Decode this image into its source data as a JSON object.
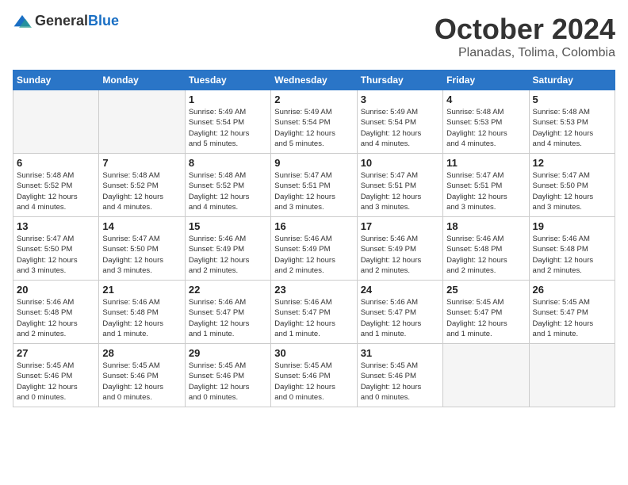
{
  "logo": {
    "general": "General",
    "blue": "Blue"
  },
  "header": {
    "month": "October 2024",
    "location": "Planadas, Tolima, Colombia"
  },
  "weekdays": [
    "Sunday",
    "Monday",
    "Tuesday",
    "Wednesday",
    "Thursday",
    "Friday",
    "Saturday"
  ],
  "weeks": [
    [
      {
        "day": "",
        "info": ""
      },
      {
        "day": "",
        "info": ""
      },
      {
        "day": "1",
        "info": "Sunrise: 5:49 AM\nSunset: 5:54 PM\nDaylight: 12 hours\nand 5 minutes."
      },
      {
        "day": "2",
        "info": "Sunrise: 5:49 AM\nSunset: 5:54 PM\nDaylight: 12 hours\nand 5 minutes."
      },
      {
        "day": "3",
        "info": "Sunrise: 5:49 AM\nSunset: 5:54 PM\nDaylight: 12 hours\nand 4 minutes."
      },
      {
        "day": "4",
        "info": "Sunrise: 5:48 AM\nSunset: 5:53 PM\nDaylight: 12 hours\nand 4 minutes."
      },
      {
        "day": "5",
        "info": "Sunrise: 5:48 AM\nSunset: 5:53 PM\nDaylight: 12 hours\nand 4 minutes."
      }
    ],
    [
      {
        "day": "6",
        "info": "Sunrise: 5:48 AM\nSunset: 5:52 PM\nDaylight: 12 hours\nand 4 minutes."
      },
      {
        "day": "7",
        "info": "Sunrise: 5:48 AM\nSunset: 5:52 PM\nDaylight: 12 hours\nand 4 minutes."
      },
      {
        "day": "8",
        "info": "Sunrise: 5:48 AM\nSunset: 5:52 PM\nDaylight: 12 hours\nand 4 minutes."
      },
      {
        "day": "9",
        "info": "Sunrise: 5:47 AM\nSunset: 5:51 PM\nDaylight: 12 hours\nand 3 minutes."
      },
      {
        "day": "10",
        "info": "Sunrise: 5:47 AM\nSunset: 5:51 PM\nDaylight: 12 hours\nand 3 minutes."
      },
      {
        "day": "11",
        "info": "Sunrise: 5:47 AM\nSunset: 5:51 PM\nDaylight: 12 hours\nand 3 minutes."
      },
      {
        "day": "12",
        "info": "Sunrise: 5:47 AM\nSunset: 5:50 PM\nDaylight: 12 hours\nand 3 minutes."
      }
    ],
    [
      {
        "day": "13",
        "info": "Sunrise: 5:47 AM\nSunset: 5:50 PM\nDaylight: 12 hours\nand 3 minutes."
      },
      {
        "day": "14",
        "info": "Sunrise: 5:47 AM\nSunset: 5:50 PM\nDaylight: 12 hours\nand 3 minutes."
      },
      {
        "day": "15",
        "info": "Sunrise: 5:46 AM\nSunset: 5:49 PM\nDaylight: 12 hours\nand 2 minutes."
      },
      {
        "day": "16",
        "info": "Sunrise: 5:46 AM\nSunset: 5:49 PM\nDaylight: 12 hours\nand 2 minutes."
      },
      {
        "day": "17",
        "info": "Sunrise: 5:46 AM\nSunset: 5:49 PM\nDaylight: 12 hours\nand 2 minutes."
      },
      {
        "day": "18",
        "info": "Sunrise: 5:46 AM\nSunset: 5:48 PM\nDaylight: 12 hours\nand 2 minutes."
      },
      {
        "day": "19",
        "info": "Sunrise: 5:46 AM\nSunset: 5:48 PM\nDaylight: 12 hours\nand 2 minutes."
      }
    ],
    [
      {
        "day": "20",
        "info": "Sunrise: 5:46 AM\nSunset: 5:48 PM\nDaylight: 12 hours\nand 2 minutes."
      },
      {
        "day": "21",
        "info": "Sunrise: 5:46 AM\nSunset: 5:48 PM\nDaylight: 12 hours\nand 1 minute."
      },
      {
        "day": "22",
        "info": "Sunrise: 5:46 AM\nSunset: 5:47 PM\nDaylight: 12 hours\nand 1 minute."
      },
      {
        "day": "23",
        "info": "Sunrise: 5:46 AM\nSunset: 5:47 PM\nDaylight: 12 hours\nand 1 minute."
      },
      {
        "day": "24",
        "info": "Sunrise: 5:46 AM\nSunset: 5:47 PM\nDaylight: 12 hours\nand 1 minute."
      },
      {
        "day": "25",
        "info": "Sunrise: 5:45 AM\nSunset: 5:47 PM\nDaylight: 12 hours\nand 1 minute."
      },
      {
        "day": "26",
        "info": "Sunrise: 5:45 AM\nSunset: 5:47 PM\nDaylight: 12 hours\nand 1 minute."
      }
    ],
    [
      {
        "day": "27",
        "info": "Sunrise: 5:45 AM\nSunset: 5:46 PM\nDaylight: 12 hours\nand 0 minutes."
      },
      {
        "day": "28",
        "info": "Sunrise: 5:45 AM\nSunset: 5:46 PM\nDaylight: 12 hours\nand 0 minutes."
      },
      {
        "day": "29",
        "info": "Sunrise: 5:45 AM\nSunset: 5:46 PM\nDaylight: 12 hours\nand 0 minutes."
      },
      {
        "day": "30",
        "info": "Sunrise: 5:45 AM\nSunset: 5:46 PM\nDaylight: 12 hours\nand 0 minutes."
      },
      {
        "day": "31",
        "info": "Sunrise: 5:45 AM\nSunset: 5:46 PM\nDaylight: 12 hours\nand 0 minutes."
      },
      {
        "day": "",
        "info": ""
      },
      {
        "day": "",
        "info": ""
      }
    ]
  ]
}
